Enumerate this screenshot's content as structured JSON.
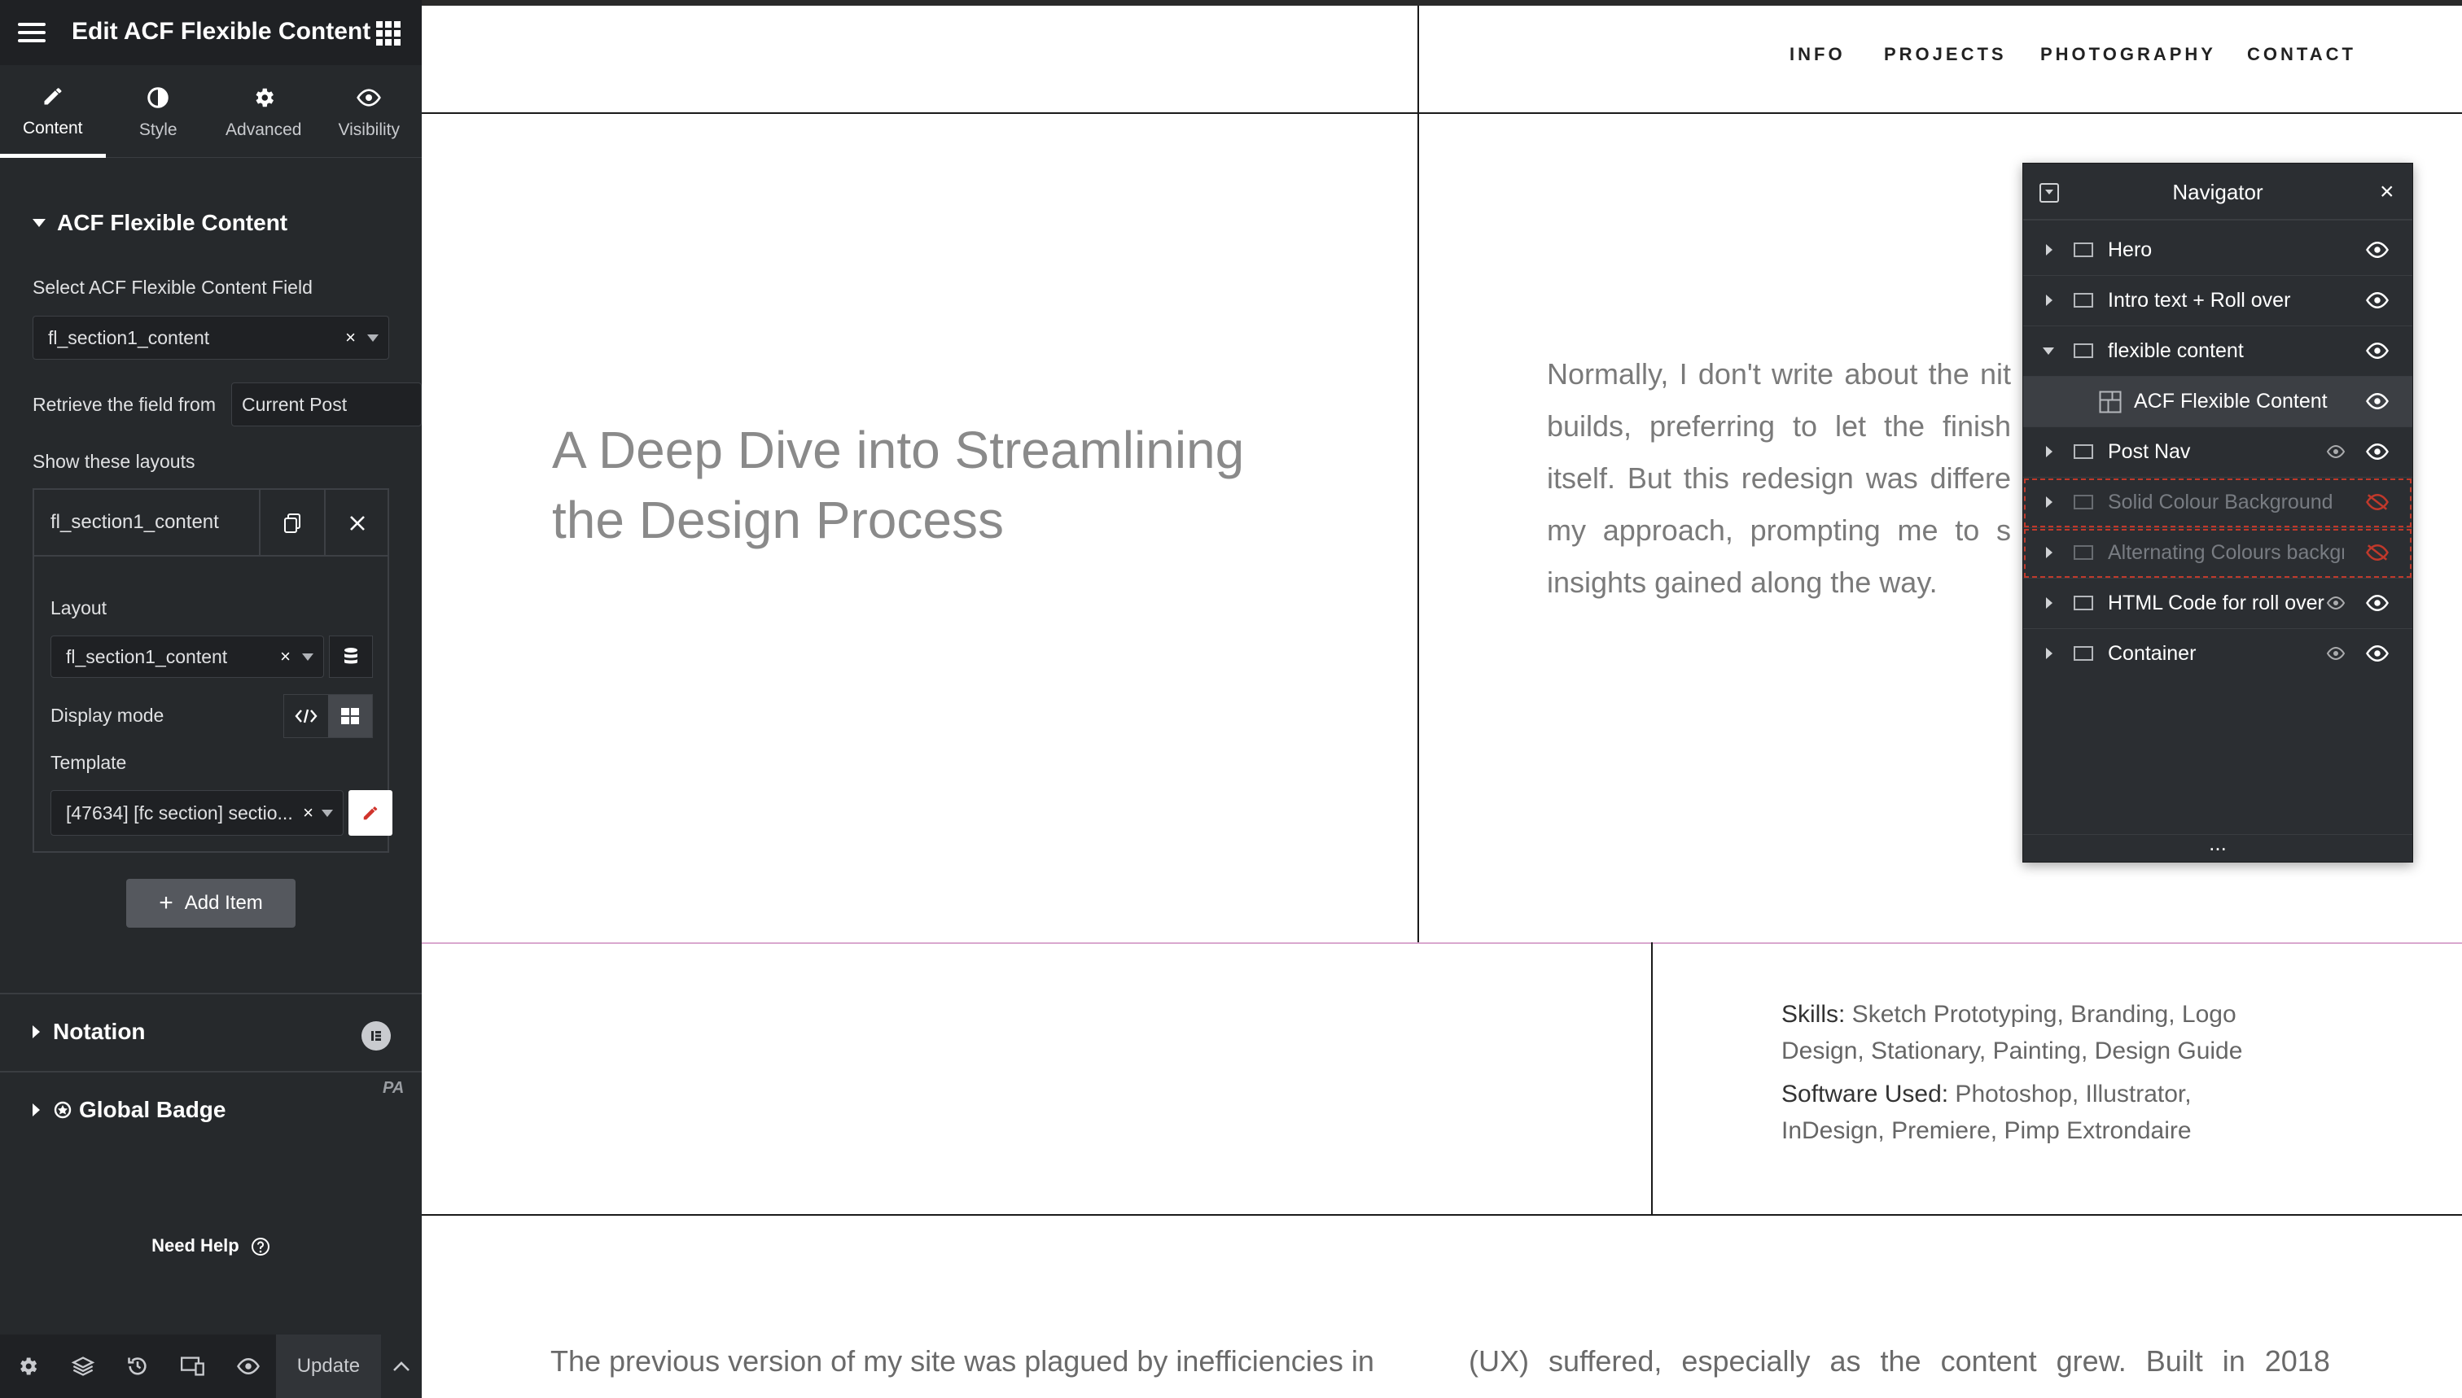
{
  "panel": {
    "title": "Edit ACF Flexible Content",
    "tabs": [
      {
        "label": "Content",
        "icon": "pencil-icon"
      },
      {
        "label": "Style",
        "icon": "half-circle-icon"
      },
      {
        "label": "Advanced",
        "icon": "gear-icon"
      },
      {
        "label": "Visibility",
        "icon": "eye-icon"
      }
    ],
    "section_title": "ACF Flexible Content",
    "select_field_label": "Select ACF Flexible Content Field",
    "select_field_value": "fl_section1_content",
    "retrieve_label": "Retrieve the field from",
    "retrieve_value": "Current Post",
    "show_layouts_label": "Show these layouts",
    "repeater_item_name": "fl_section1_content",
    "layout_label": "Layout",
    "layout_value": "fl_section1_content",
    "display_mode_label": "Display mode",
    "template_label": "Template",
    "template_value": "[47634] [fc section] sectio...",
    "add_item_label": "Add Item",
    "notation_title": "Notation",
    "global_badge_title": "Global Badge",
    "pa_badge": "PA",
    "need_help": "Need Help",
    "update_label": "Update"
  },
  "site": {
    "nav": [
      "INFO",
      "PROJECTS",
      "PHOTOGRAPHY",
      "CONTACT"
    ],
    "hero_title": "A Deep Dive into Streamlining the Design Process",
    "intro_text": "Normally, I don't write about the nit builds, preferring to let the finish itself. But this redesign was differe my approach, prompting me to s insights gained along the way.",
    "skills_label": "Skills:",
    "skills_value": " Sketch Prototyping, Branding, Logo Design, Stationary, Painting, Design Guide",
    "software_label": "Software Used:",
    "software_value": " Photoshop, Illustrator, InDesign, Premiere, Pimp Extrondaire",
    "para_left": "The previous version of my site was plagued by inefficiencies in",
    "para_right": "(UX) suffered, especially as the content grew. Built in 2018"
  },
  "navigator": {
    "title": "Navigator",
    "items": [
      {
        "label": "Hero",
        "state": "normal"
      },
      {
        "label": "Intro text + Roll over",
        "state": "normal"
      },
      {
        "label": "flexible content",
        "state": "expanded"
      },
      {
        "label": "ACF Flexible Content",
        "state": "selected-child"
      },
      {
        "label": "Post Nav",
        "state": "normal"
      },
      {
        "label": "Solid Colour Background",
        "state": "hidden"
      },
      {
        "label": "Alternating Colours background",
        "state": "hidden"
      },
      {
        "label": "HTML Code for roll over",
        "state": "normal"
      },
      {
        "label": "Container",
        "state": "normal"
      }
    ],
    "footer": "..."
  },
  "colors": {
    "panel_bg": "#26292c",
    "panel_dark": "#1f2124",
    "hidden_outline": "#c0392b",
    "accent_red": "#d0342c"
  }
}
